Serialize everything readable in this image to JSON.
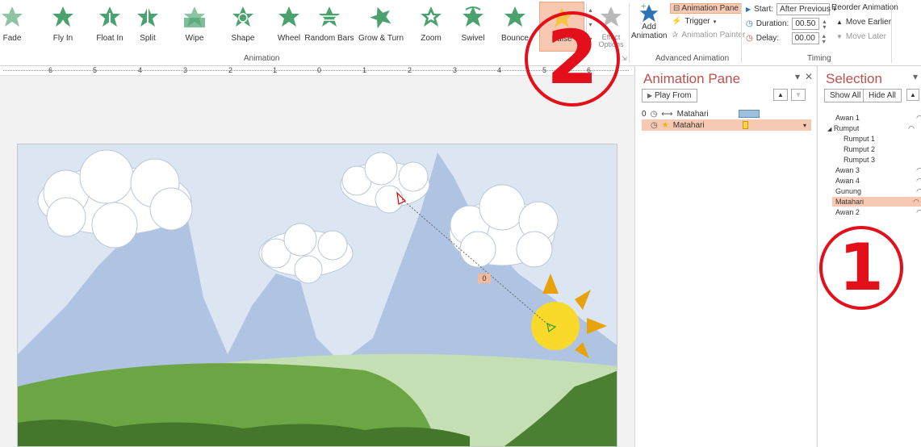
{
  "ribbon": {
    "effects": [
      {
        "label": "Fade",
        "icon": "fade-star-icon"
      },
      {
        "label": "Fly In",
        "icon": "fly-in-star-icon"
      },
      {
        "label": "Float In",
        "icon": "float-in-star-icon"
      },
      {
        "label": "Split",
        "icon": "split-star-icon"
      },
      {
        "label": "Wipe",
        "icon": "wipe-star-icon"
      },
      {
        "label": "Shape",
        "icon": "shape-star-icon"
      },
      {
        "label": "Wheel",
        "icon": "wheel-star-icon"
      },
      {
        "label": "Random Bars",
        "icon": "random-bars-star-icon"
      },
      {
        "label": "Grow & Turn",
        "icon": "grow-turn-star-icon"
      },
      {
        "label": "Zoom",
        "icon": "zoom-star-icon"
      },
      {
        "label": "Swivel",
        "icon": "swivel-star-icon"
      },
      {
        "label": "Bounce",
        "icon": "bounce-star-icon"
      },
      {
        "label": "Pulse",
        "icon": "pulse-star-icon"
      }
    ],
    "effect_options_label": "Effect Options",
    "animation_group_label": "Animation",
    "add_animation_label": "Add Animation",
    "animation_pane_label": "Animation Pane",
    "trigger_label": "Trigger",
    "animation_painter_label": "Animation Painter",
    "advanced_group_label": "Advanced Animation",
    "start_label": "Start:",
    "start_value": "After Previous",
    "duration_label": "Duration:",
    "duration_value": "00.50",
    "delay_label": "Delay:",
    "delay_value": "00.00",
    "reorder_label": "Reorder Animation",
    "move_earlier_label": "Move Earlier",
    "move_later_label": "Move Later",
    "timing_group_label": "Timing"
  },
  "ruler": {
    "numbers": [
      "6",
      "5",
      "4",
      "3",
      "2",
      "1",
      "0",
      "1",
      "2",
      "3",
      "4",
      "5",
      "6"
    ]
  },
  "slide": {
    "motion_tag": "0"
  },
  "animation_pane": {
    "title": "Animation Pane",
    "play_from_label": "Play From",
    "items": [
      {
        "index": "0",
        "name": "Matahari",
        "type": "motion-path"
      },
      {
        "index": "",
        "name": "Matahari",
        "type": "emphasis"
      }
    ]
  },
  "selection_pane": {
    "title": "Selection",
    "show_all_label": "Show All",
    "hide_all_label": "Hide All",
    "items": [
      {
        "name": "Awan 1",
        "indent": false,
        "group": false,
        "selected": false
      },
      {
        "name": "Rumput",
        "indent": false,
        "group": true,
        "selected": false
      },
      {
        "name": "Rumput 1",
        "indent": true,
        "group": false,
        "selected": false
      },
      {
        "name": "Rumput 2",
        "indent": true,
        "group": false,
        "selected": false
      },
      {
        "name": "Rumput 3",
        "indent": true,
        "group": false,
        "selected": false
      },
      {
        "name": "Awan 3",
        "indent": false,
        "group": false,
        "selected": false
      },
      {
        "name": "Awan 4",
        "indent": false,
        "group": false,
        "selected": false
      },
      {
        "name": "Gunung",
        "indent": false,
        "group": false,
        "selected": false
      },
      {
        "name": "Matahari",
        "indent": false,
        "group": false,
        "selected": true
      },
      {
        "name": "Awan 2",
        "indent": false,
        "group": false,
        "selected": false
      }
    ]
  },
  "callouts": {
    "one": "1",
    "two": "2"
  },
  "colors": {
    "accent": "#c0504d",
    "selected": "#f8c9b2",
    "callout": "#e3101b"
  }
}
